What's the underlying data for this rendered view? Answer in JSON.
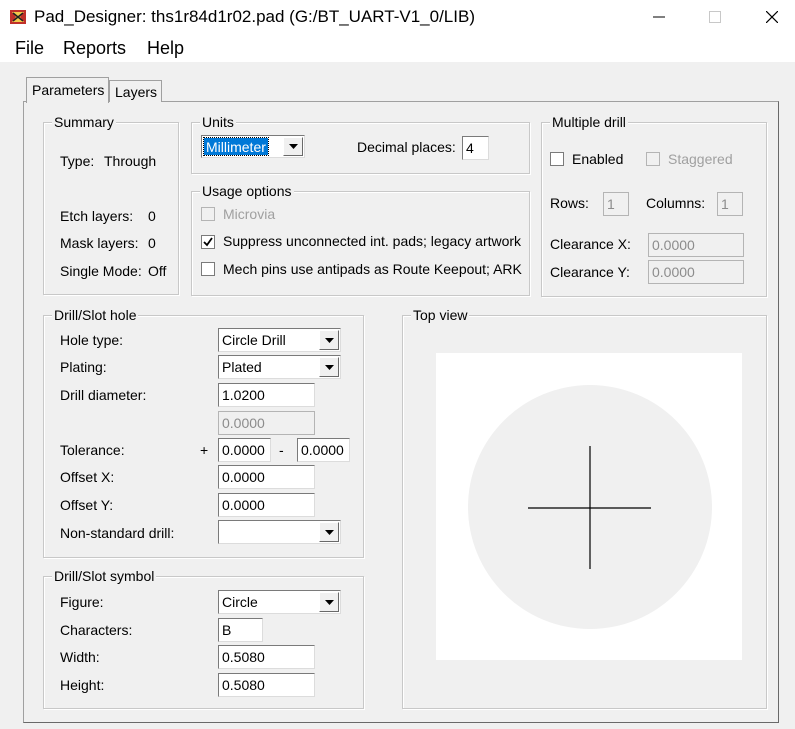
{
  "window": {
    "title": "Pad_Designer: ths1r84d1r02.pad (G:/BT_UART-V1_0/LIB)"
  },
  "menu": {
    "file": "File",
    "reports": "Reports",
    "help": "Help"
  },
  "tabs": {
    "parameters": "Parameters",
    "layers": "Layers"
  },
  "summary": {
    "title": "Summary",
    "type_label": "Type:",
    "type_value": "Through",
    "etch_label": "Etch layers:",
    "etch_value": "0",
    "mask_label": "Mask layers:",
    "mask_value": "0",
    "single_label": "Single Mode:",
    "single_value": "Off"
  },
  "units": {
    "title": "Units",
    "unit_value": "Millimeter",
    "decimal_label": "Decimal places:",
    "decimal_value": "4"
  },
  "usage": {
    "title": "Usage options",
    "microvia": "Microvia",
    "suppress": "Suppress unconnected int. pads; legacy artwork",
    "mech": "Mech pins use antipads as Route Keepout; ARK"
  },
  "multiple_drill": {
    "title": "Multiple drill",
    "enabled": "Enabled",
    "staggered": "Staggered",
    "rows_label": "Rows:",
    "rows_value": "1",
    "columns_label": "Columns:",
    "columns_value": "1",
    "clearance_x_label": "Clearance X:",
    "clearance_x_value": "0.0000",
    "clearance_y_label": "Clearance Y:",
    "clearance_y_value": "0.0000"
  },
  "drill_slot_hole": {
    "title": "Drill/Slot hole",
    "hole_type_label": "Hole type:",
    "hole_type_value": "Circle Drill",
    "plating_label": "Plating:",
    "plating_value": "Plated",
    "drill_diameter_label": "Drill diameter:",
    "drill_diameter_value": "1.0200",
    "slot_value": "0.0000",
    "tolerance_label": "Tolerance:",
    "plus": "+",
    "tol_plus_value": "0.0000",
    "minus": "-",
    "tol_minus_value": "0.0000",
    "offset_x_label": "Offset X:",
    "offset_x_value": "0.0000",
    "offset_y_label": "Offset Y:",
    "offset_y_value": "0.0000",
    "nonstandard_label": "Non-standard drill:",
    "nonstandard_value": ""
  },
  "drill_slot_symbol": {
    "title": "Drill/Slot symbol",
    "figure_label": "Figure:",
    "figure_value": "Circle",
    "characters_label": "Characters:",
    "characters_value": "B",
    "width_label": "Width:",
    "width_value": "0.5080",
    "height_label": "Height:",
    "height_value": "0.5080"
  },
  "top_view": {
    "title": "Top view"
  },
  "checkbox_states": {
    "microvia": false,
    "suppress": true,
    "mech": false,
    "enabled": false,
    "staggered": false
  },
  "colors": {
    "dialog_bg": "#f0f0f0",
    "selection": "#0078d7",
    "pad_circle": "#f0f0f0",
    "crosshair": "#000000",
    "app_icon": "#c0302a"
  }
}
